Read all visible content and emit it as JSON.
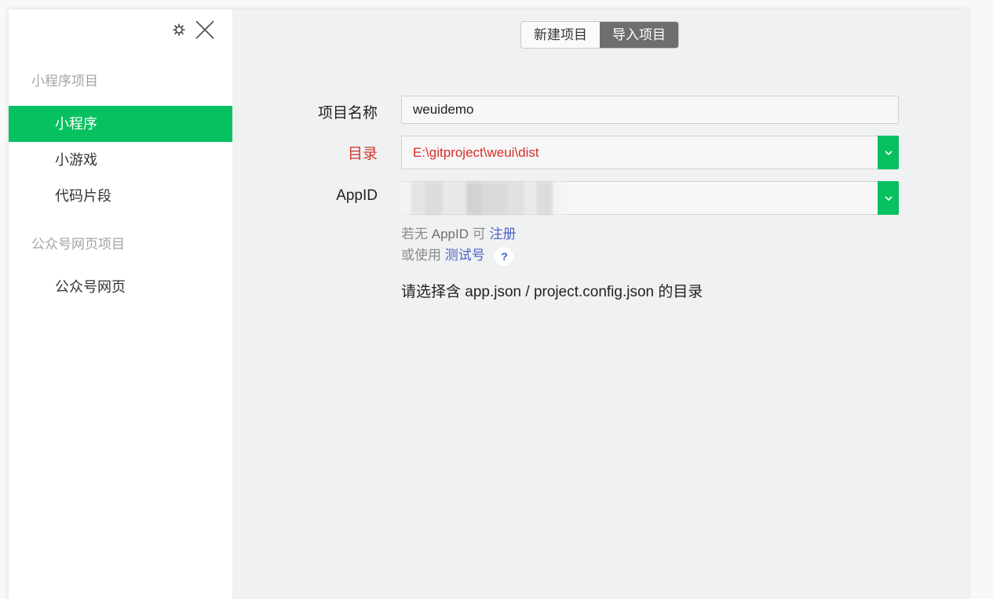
{
  "sidebar": {
    "sections": [
      {
        "title": "小程序项目",
        "items": [
          {
            "label": "小程序",
            "active": true
          },
          {
            "label": "小游戏",
            "active": false
          },
          {
            "label": "代码片段",
            "active": false
          }
        ]
      },
      {
        "title": "公众号网页项目",
        "items": [
          {
            "label": "公众号网页",
            "active": false
          }
        ]
      }
    ],
    "icons": {
      "settings": "gear-icon",
      "close": "close-icon"
    }
  },
  "tabs": [
    {
      "label": "新建项目",
      "active": false
    },
    {
      "label": "导入项目",
      "active": true
    }
  ],
  "form": {
    "project_name": {
      "label": "项目名称",
      "value": "weuidemo"
    },
    "directory": {
      "label": "目录",
      "value": "E:\\gitproject\\weui\\dist"
    },
    "appid": {
      "label": "AppID",
      "value": ""
    },
    "helper": {
      "line1_prefix": "若无",
      "line1_strong": "AppID",
      "line1_mid": "可",
      "register_link": "注册",
      "line2_prefix": "或使用",
      "test_link": "测试号",
      "help": "?"
    },
    "hint": "请选择含 app.json / project.config.json 的目录"
  },
  "colors": {
    "accent": "#07c160",
    "error": "#d23a32",
    "link": "#4a63c8",
    "tab_active": "#6e6e6e"
  }
}
